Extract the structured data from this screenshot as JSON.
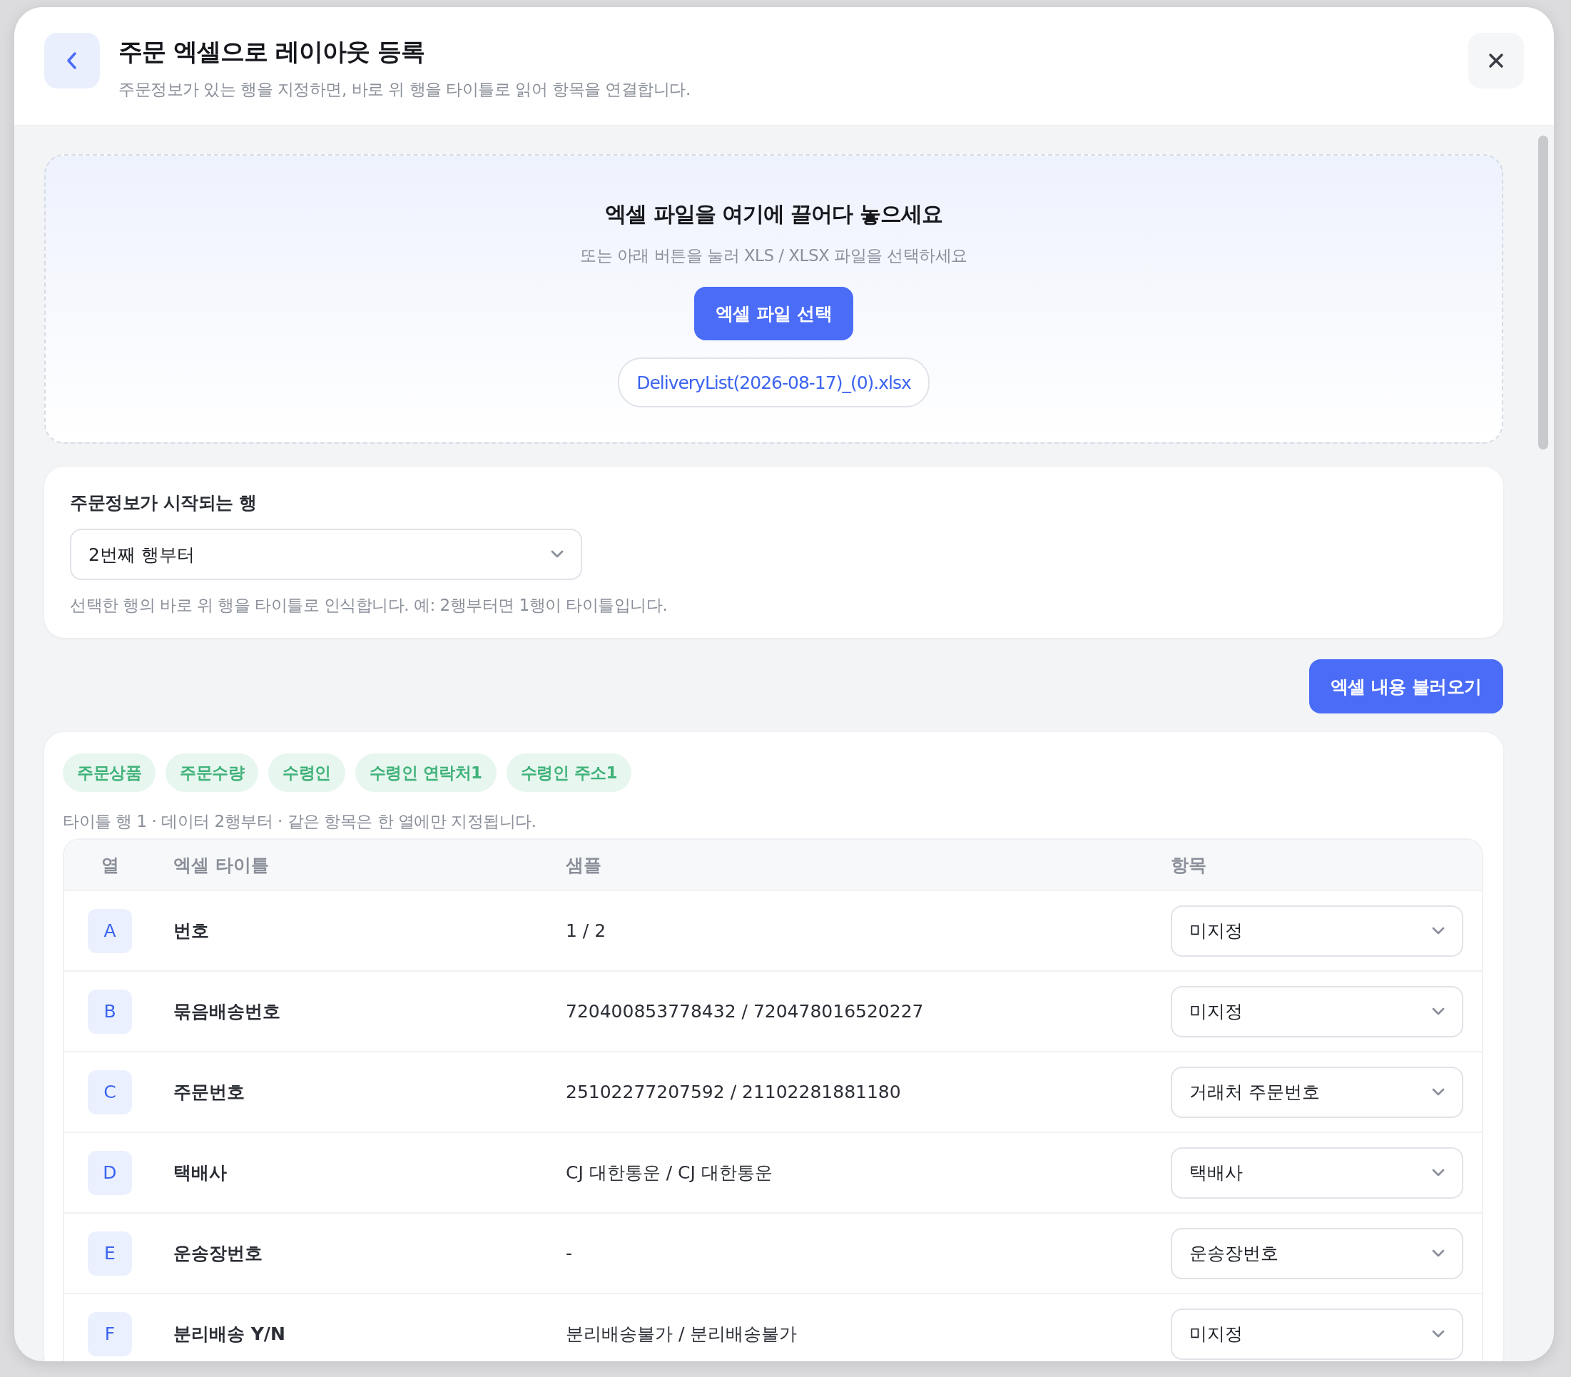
{
  "header": {
    "title": "주문 엑셀으로 레이아웃 등록",
    "subtitle": "주문정보가 있는 행을 지정하면, 바로 위 행을 타이틀로 읽어 항목을 연결합니다."
  },
  "dropzone": {
    "title": "엑셀 파일을 여기에 끌어다 놓으세요",
    "subtitle": "또는 아래 버튼을 눌러 XLS / XLSX 파일을 선택하세요",
    "button": "엑셀 파일 선택",
    "file_name": "DeliveryList(2026-08-17)_(0).xlsx"
  },
  "start_row": {
    "label": "주문정보가 시작되는 행",
    "value": "2번째 행부터",
    "hint": "선택한 행의 바로 위 행을 타이틀로 인식합니다. 예: 2행부터면 1행이 타이틀입니다."
  },
  "load_button": "엑셀 내용 불러오기",
  "mapping": {
    "tags": [
      "주문상품",
      "주문수량",
      "수령인",
      "수령인 연락처1",
      "수령인 주소1"
    ],
    "hint": "타이틀 행 1 · 데이터 2행부터 · 같은 항목은 한 열에만 지정됩니다.",
    "columns": [
      "열",
      "엑셀 타이틀",
      "샘플",
      "항목"
    ],
    "rows": [
      {
        "column": "A",
        "title": "번호",
        "sample": "1 / 2",
        "field": "미지정"
      },
      {
        "column": "B",
        "title": "묶음배송번호",
        "sample": "720400853778432 / 720478016520227",
        "field": "미지정"
      },
      {
        "column": "C",
        "title": "주문번호",
        "sample": "25102277207592 / 21102281881180",
        "field": "거래처 주문번호"
      },
      {
        "column": "D",
        "title": "택배사",
        "sample": "CJ 대한통운 / CJ 대한통운",
        "field": "택배사"
      },
      {
        "column": "E",
        "title": "운송장번호",
        "sample": "-",
        "field": "운송장번호"
      },
      {
        "column": "F",
        "title": "분리배송 Y/N",
        "sample": "분리배송불가 / 분리배송불가",
        "field": "미지정"
      }
    ]
  }
}
